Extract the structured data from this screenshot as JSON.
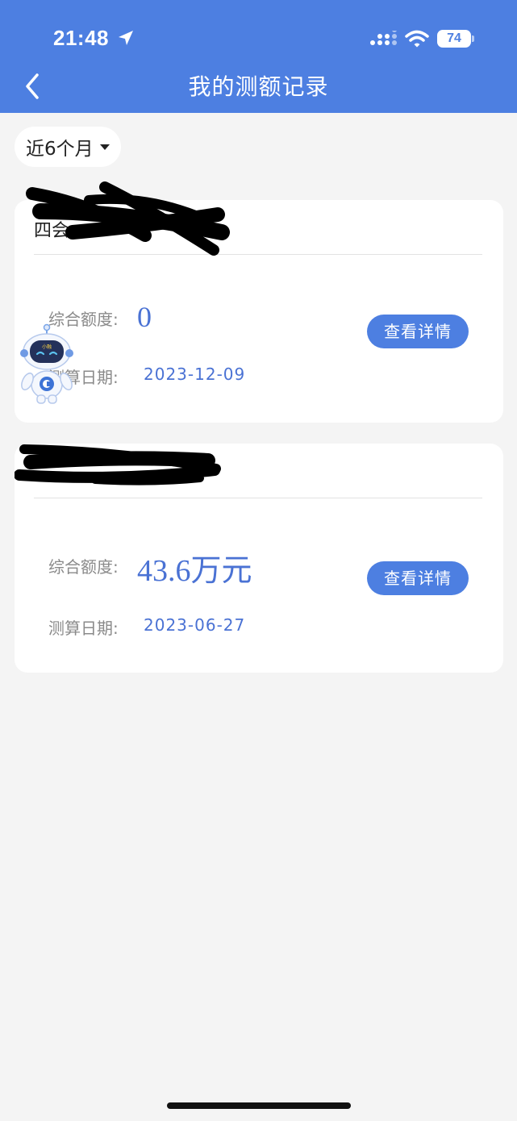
{
  "status_bar": {
    "time": "21:48",
    "battery": "74"
  },
  "header": {
    "title": "我的测额记录"
  },
  "filter": {
    "label": "近6个月"
  },
  "records": [
    {
      "title": "四会",
      "quota_label": "综合额度:",
      "quota_value": "0",
      "date_label": "测算日期:",
      "date_value": "2023-12-09",
      "button_label": "查看详情"
    },
    {
      "title": "",
      "quota_label": "综合额度:",
      "quota_value": "43.6万元",
      "date_label": "测算日期:",
      "date_value": "2023-06-27",
      "button_label": "查看详情"
    }
  ],
  "mascot": {
    "badge": "小融"
  },
  "colors": {
    "brand_blue": "#4d7fe1",
    "value_blue": "#4a72d4",
    "background": "#f4f4f4",
    "label_gray": "#8a8a8a"
  },
  "icons": [
    "location-arrow-icon",
    "cellular-signal-icon",
    "wifi-icon",
    "battery-icon",
    "back-chevron-icon",
    "caret-down-icon",
    "robot-mascot-icon"
  ]
}
